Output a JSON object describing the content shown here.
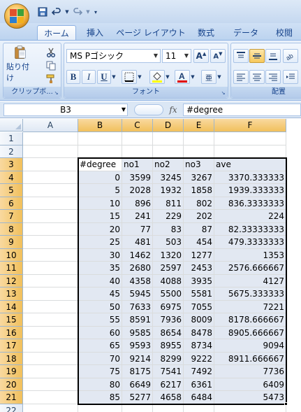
{
  "quick_access": {
    "save_icon": "save-icon",
    "undo_icon": "undo-icon",
    "redo_icon": "redo-icon"
  },
  "tabs": [
    "ホーム",
    "挿入",
    "ページ レイアウト",
    "数式",
    "データ",
    "校閲"
  ],
  "active_tab": "ホーム",
  "ribbon": {
    "clipboard": {
      "paste_label": "貼り付け",
      "group_label": "クリップボ..."
    },
    "font": {
      "font_name": "MS Pゴシック",
      "font_size": "11",
      "bold": "B",
      "italic": "I",
      "underline": "U",
      "group_label": "フォント"
    },
    "alignment": {
      "group_label": "配置"
    }
  },
  "formula_bar": {
    "name_box": "B3",
    "fx": "fx",
    "formula": "#degree"
  },
  "sheet": {
    "column_headers": [
      "A",
      "B",
      "C",
      "D",
      "E",
      "F"
    ],
    "row_headers": [
      "1",
      "2",
      "3",
      "4",
      "5",
      "6",
      "7",
      "8",
      "9",
      "10",
      "11",
      "12",
      "13",
      "14",
      "15",
      "16",
      "17",
      "18",
      "19",
      "20",
      "21",
      "22"
    ],
    "selected_column_headers": [
      "B",
      "C",
      "D",
      "E",
      "F"
    ],
    "selected_rows": [
      "3",
      "4",
      "5",
      "6",
      "7",
      "8",
      "9",
      "10",
      "11",
      "12",
      "13",
      "14",
      "15",
      "16",
      "17",
      "18",
      "19",
      "20",
      "21"
    ],
    "header_row": [
      "#degree",
      "no1",
      "no2",
      "no3",
      "ave"
    ],
    "rows": [
      [
        "0",
        "3599",
        "3245",
        "3267",
        "3370.333333"
      ],
      [
        "5",
        "2028",
        "1932",
        "1858",
        "1939.333333"
      ],
      [
        "10",
        "896",
        "811",
        "802",
        "836.3333333"
      ],
      [
        "15",
        "241",
        "229",
        "202",
        "224"
      ],
      [
        "20",
        "77",
        "83",
        "87",
        "82.33333333"
      ],
      [
        "25",
        "481",
        "503",
        "454",
        "479.3333333"
      ],
      [
        "30",
        "1462",
        "1320",
        "1277",
        "1353"
      ],
      [
        "35",
        "2680",
        "2597",
        "2453",
        "2576.666667"
      ],
      [
        "40",
        "4358",
        "4088",
        "3935",
        "4127"
      ],
      [
        "45",
        "5945",
        "5500",
        "5581",
        "5675.333333"
      ],
      [
        "50",
        "7633",
        "6975",
        "7055",
        "7221"
      ],
      [
        "55",
        "8591",
        "7936",
        "8009",
        "8178.666667"
      ],
      [
        "60",
        "9585",
        "8654",
        "8478",
        "8905.666667"
      ],
      [
        "65",
        "9593",
        "8955",
        "8734",
        "9094"
      ],
      [
        "70",
        "9214",
        "8299",
        "9222",
        "8911.666667"
      ],
      [
        "75",
        "8175",
        "7541",
        "7492",
        "7736"
      ],
      [
        "80",
        "6649",
        "6217",
        "6361",
        "6409"
      ],
      [
        "85",
        "5277",
        "4658",
        "6484",
        "5473"
      ]
    ]
  }
}
